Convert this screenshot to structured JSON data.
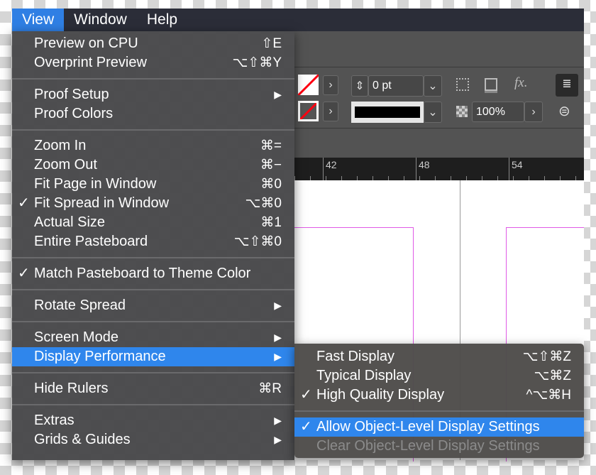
{
  "menubar": {
    "items": [
      "View",
      "Window",
      "Help"
    ],
    "active": "View"
  },
  "toolbar": {
    "stroke_weight": "0 pt",
    "opacity": "100%",
    "fx_label": "fx."
  },
  "ruler": {
    "labels": [
      "42",
      "48",
      "54"
    ]
  },
  "view_menu": {
    "groups": [
      [
        {
          "label": "Preview on CPU",
          "shortcut": "⇧E"
        },
        {
          "label": "Overprint Preview",
          "shortcut": "⌥⇧⌘Y"
        }
      ],
      [
        {
          "label": "Proof Setup",
          "submenu": true
        },
        {
          "label": "Proof Colors"
        }
      ],
      [
        {
          "label": "Zoom In",
          "shortcut": "⌘="
        },
        {
          "label": "Zoom Out",
          "shortcut": "⌘−"
        },
        {
          "label": "Fit Page in Window",
          "shortcut": "⌘0"
        },
        {
          "label": "Fit Spread in Window",
          "shortcut": "⌥⌘0",
          "checked": true
        },
        {
          "label": "Actual Size",
          "shortcut": "⌘1"
        },
        {
          "label": "Entire Pasteboard",
          "shortcut": "⌥⇧⌘0"
        }
      ],
      [
        {
          "label": "Match Pasteboard to Theme Color",
          "checked": true
        }
      ],
      [
        {
          "label": "Rotate Spread",
          "submenu": true
        }
      ],
      [
        {
          "label": "Screen Mode",
          "submenu": true
        },
        {
          "label": "Display Performance",
          "submenu": true,
          "highlighted": true
        }
      ],
      [
        {
          "label": "Hide Rulers",
          "shortcut": "⌘R"
        }
      ],
      [
        {
          "label": "Extras",
          "submenu": true
        },
        {
          "label": "Grids & Guides",
          "submenu": true
        }
      ]
    ]
  },
  "display_submenu": {
    "groups": [
      [
        {
          "label": "Fast Display",
          "shortcut": "⌥⇧⌘Z"
        },
        {
          "label": "Typical Display",
          "shortcut": "⌥⌘Z"
        },
        {
          "label": "High Quality Display",
          "shortcut": "^⌥⌘H",
          "checked": true
        }
      ],
      [
        {
          "label": "Allow Object-Level Display Settings",
          "checked": true,
          "highlighted": true
        },
        {
          "label": "Clear Object-Level Display Settings",
          "disabled": true
        }
      ]
    ]
  },
  "glyphs": {
    "check": "✓",
    "submenu_arrow": "▶",
    "chevron_right": "›",
    "chevron_down": "⌄"
  },
  "colors": {
    "highlight": "#2f86ec",
    "guide": "#e05ae6"
  }
}
